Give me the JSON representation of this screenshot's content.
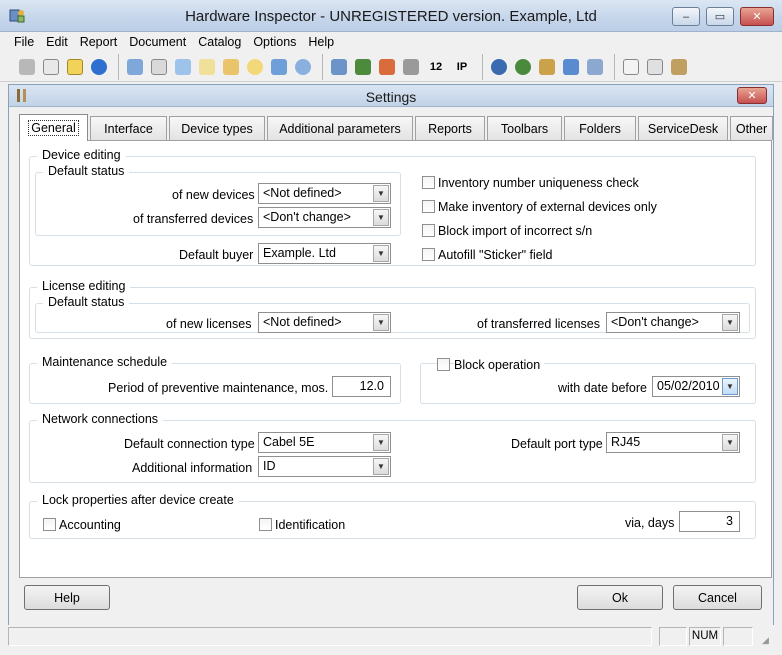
{
  "window": {
    "title": "Hardware Inspector - UNREGISTERED version. Example, Ltd",
    "minimize": "–",
    "maximize": "▭",
    "close": "✕"
  },
  "menu": [
    "File",
    "Edit",
    "Report",
    "Document",
    "Catalog",
    "Options",
    "Help"
  ],
  "toolbar": {
    "number_icon_text": "12",
    "ip_icon_text": "IP"
  },
  "dialog": {
    "title": "Settings",
    "close": "✕",
    "tabs": [
      "General",
      "Interface",
      "Device types",
      "Additional parameters",
      "Reports",
      "Toolbars",
      "Folders",
      "ServiceDesk",
      "Other"
    ],
    "active_tab": "General"
  },
  "device_editing": {
    "legend": "Device editing",
    "default_status_legend": "Default status",
    "new_devices_label": "of new devices",
    "new_devices_value": "<Not defined>",
    "transferred_devices_label": "of transferred devices",
    "transferred_devices_value": "<Don't change>",
    "default_buyer_label": "Default buyer",
    "default_buyer_value": "Example. Ltd",
    "checks": [
      {
        "label": "Inventory number uniqueness check",
        "checked": false
      },
      {
        "label": "Make inventory of external devices only",
        "checked": false
      },
      {
        "label": "Block import of incorrect s/n",
        "checked": false
      },
      {
        "label": "Autofill \"Sticker\" field",
        "checked": false
      }
    ]
  },
  "license_editing": {
    "legend": "License editing",
    "default_status_legend": "Default status",
    "new_licenses_label": "of new licenses",
    "new_licenses_value": "<Not defined>",
    "transferred_licenses_label": "of transferred licenses",
    "transferred_licenses_value": "<Don't change>"
  },
  "maintenance": {
    "legend": "Maintenance schedule",
    "period_label": "Period of preventive maintenance, mos.",
    "period_value": "12.0"
  },
  "block_operation": {
    "label": "Block operation",
    "checked": false,
    "date_label": "with date before",
    "date_value": "05/02/2010"
  },
  "network": {
    "legend": "Network connections",
    "connection_type_label": "Default connection type",
    "connection_type_value": "Cabel 5E",
    "additional_info_label": "Additional information",
    "additional_info_value": "ID",
    "port_type_label": "Default port type",
    "port_type_value": "RJ45"
  },
  "lock_properties": {
    "legend": "Lock properties after device create",
    "accounting_label": "Accounting",
    "accounting_checked": false,
    "identification_label": "Identification",
    "identification_checked": false,
    "via_days_label": "via, days",
    "via_days_value": "3"
  },
  "buttons": {
    "help": "Help",
    "ok": "Ok",
    "cancel": "Cancel"
  },
  "statusbar": {
    "num": "NUM"
  }
}
